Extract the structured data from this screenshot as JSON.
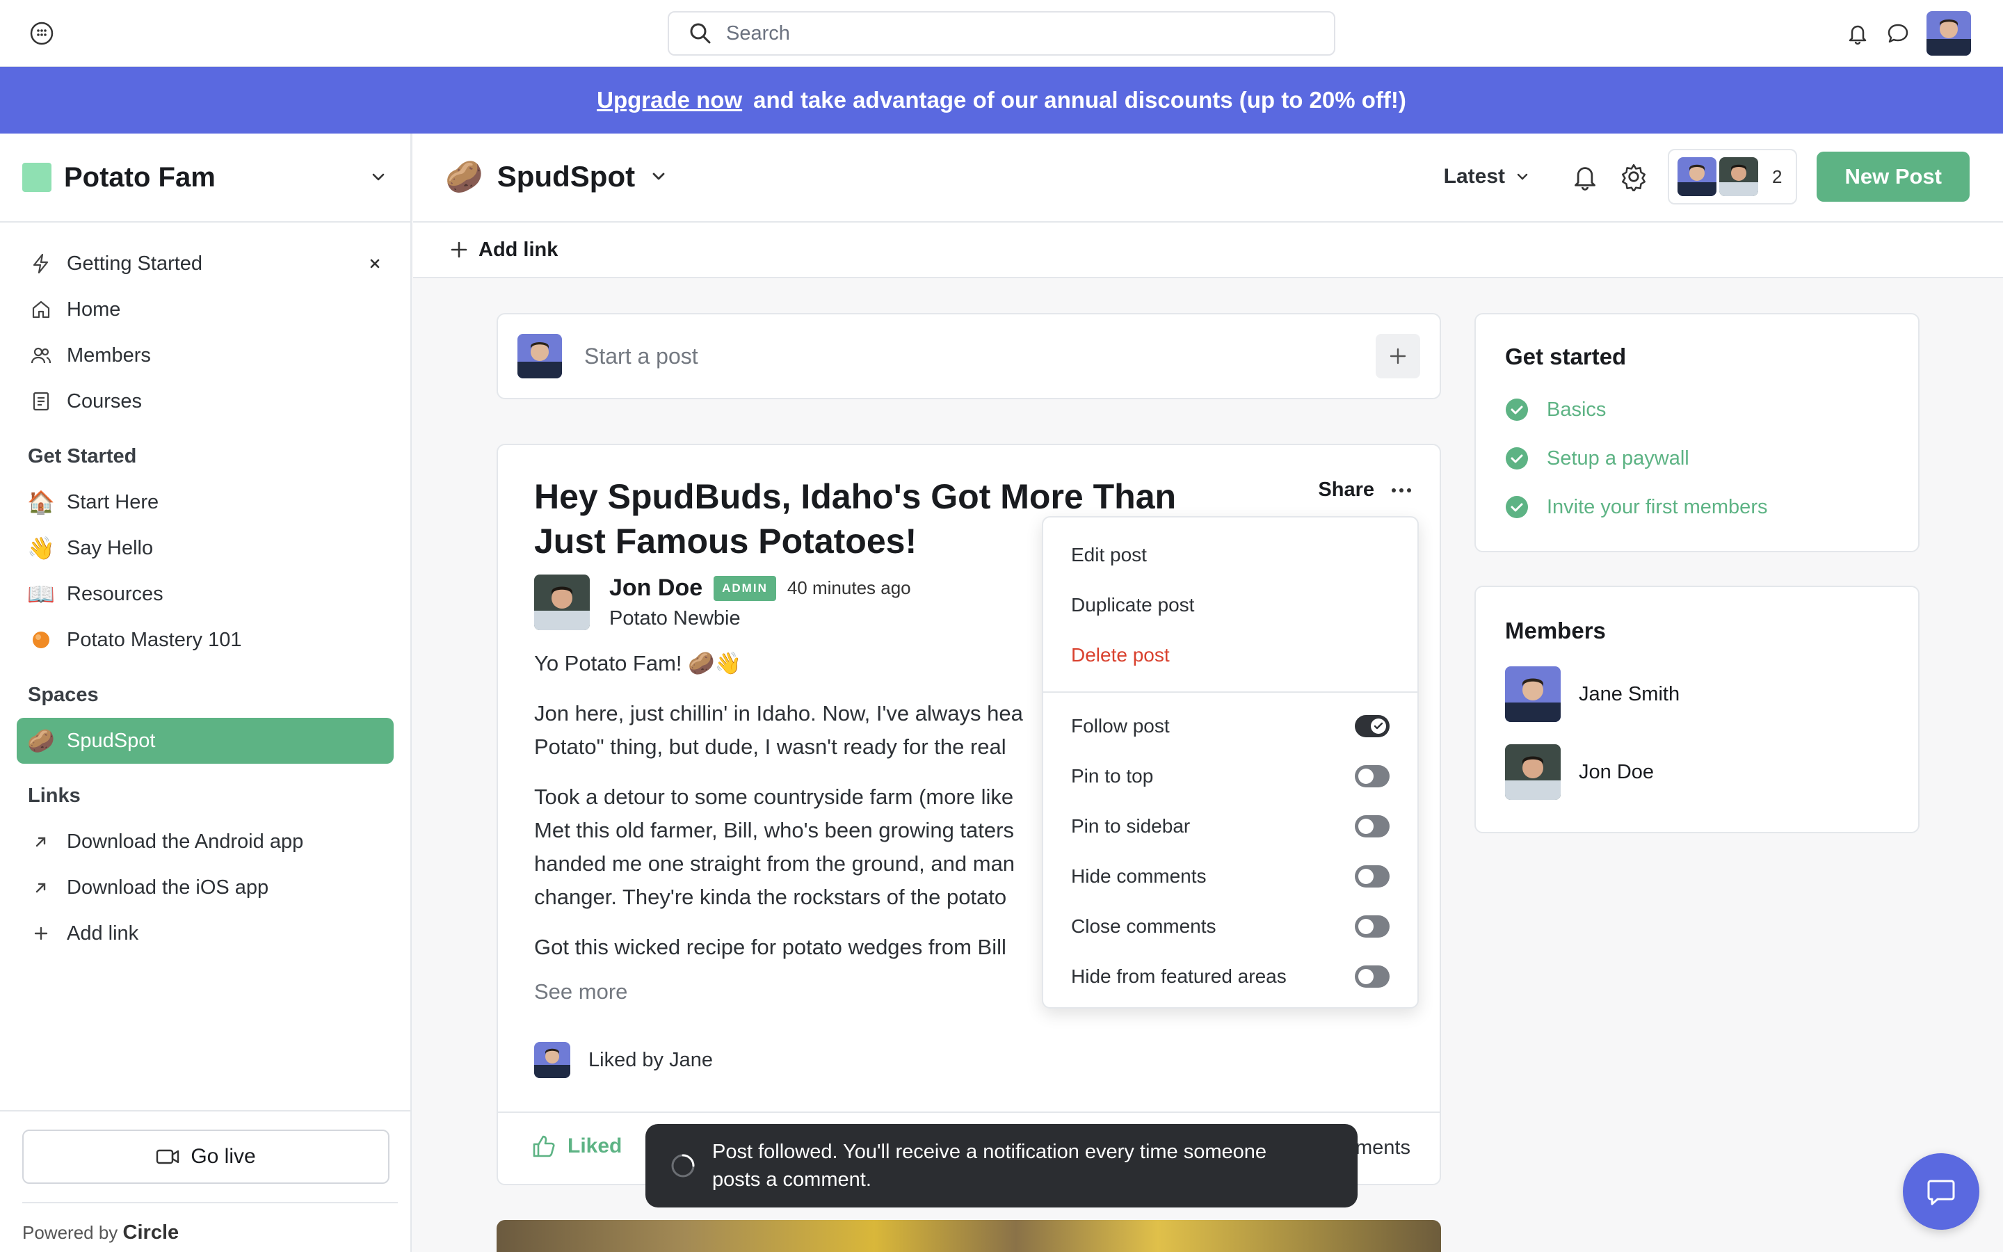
{
  "topbar": {
    "search_placeholder": "Search",
    "icons": [
      "grid-icon",
      "search-icon",
      "bell-icon",
      "chat-icon"
    ]
  },
  "banner": {
    "link_text": "Upgrade now",
    "message": "and take advantage of our annual discounts (up to 20% off!)"
  },
  "sidebar": {
    "community_name": "Potato Fam",
    "community_color": "#8fe0b2",
    "nav": [
      {
        "label": "Getting Started",
        "icon": "bolt-icon"
      },
      {
        "label": "Home",
        "icon": "home-icon"
      },
      {
        "label": "Members",
        "icon": "members-icon"
      },
      {
        "label": "Courses",
        "icon": "courses-icon"
      }
    ],
    "get_started_title": "Get Started",
    "get_started": [
      {
        "label": "Start Here",
        "emoji": "🏠"
      },
      {
        "label": "Say Hello",
        "emoji": "👋"
      },
      {
        "label": "Resources",
        "emoji": "📖"
      },
      {
        "label": "Potato Mastery 101",
        "emoji": "🟠"
      }
    ],
    "spaces_title": "Spaces",
    "spaces": [
      {
        "label": "SpudSpot",
        "emoji": "🥔"
      }
    ],
    "links_title": "Links",
    "links": [
      {
        "label": "Download the Android app"
      },
      {
        "label": "Download the iOS app"
      },
      {
        "label": "Add link"
      }
    ],
    "go_live": "Go live",
    "powered_by": "Powered by",
    "powered_brand": "Circle"
  },
  "space": {
    "emoji": "🥔",
    "name": "SpudSpot",
    "sort_label": "Latest",
    "member_count": "2",
    "new_post": "New Post",
    "add_link": "Add link"
  },
  "composer": {
    "placeholder": "Start a post"
  },
  "post": {
    "title": "Hey SpudBuds, Idaho's Got More Than Just Famous Potatoes!",
    "share": "Share",
    "author": "Jon Doe",
    "badge": "ADMIN",
    "time_ago": "40 minutes ago",
    "headline": "Potato Newbie",
    "greeting": "Yo Potato Fam! 🥔👋",
    "p1a": "Jon here, just chillin' in Idaho. Now, I've always hea",
    "p1b": "Potato\" thing, but dude, I wasn't ready for the real",
    "p2a": "Took a detour to some countryside farm (more like",
    "p2b": "Met this old farmer, Bill, who's been growing taters",
    "p2c": "handed me one straight from the ground, and man",
    "p2d": "changer. They're kinda the rockstars of the potato",
    "p3a": "Got this wicked recipe for potato wedges from Bill",
    "see_more": "See more",
    "liked_by": "Liked by Jane",
    "liked": "Liked",
    "comments": "ments"
  },
  "menu": {
    "edit": "Edit post",
    "duplicate": "Duplicate post",
    "delete": "Delete post",
    "toggles": [
      {
        "label": "Follow post",
        "on": true
      },
      {
        "label": "Pin to top",
        "on": false
      },
      {
        "label": "Pin to sidebar",
        "on": false
      },
      {
        "label": "Hide comments",
        "on": false
      },
      {
        "label": "Close comments",
        "on": false
      },
      {
        "label": "Hide from featured areas",
        "on": false
      }
    ]
  },
  "get_started_card": {
    "title": "Get started",
    "items": [
      "Basics",
      "Setup a paywall",
      "Invite your first members"
    ]
  },
  "members_card": {
    "title": "Members",
    "members": [
      "Jane Smith",
      "Jon Doe"
    ]
  },
  "toast": {
    "line1": "Post followed. You'll receive a notification every time someone",
    "line2": "posts a comment."
  },
  "colors": {
    "accent_green": "#5db384",
    "banner_blue": "#5a69e0",
    "danger_red": "#d9412e"
  }
}
